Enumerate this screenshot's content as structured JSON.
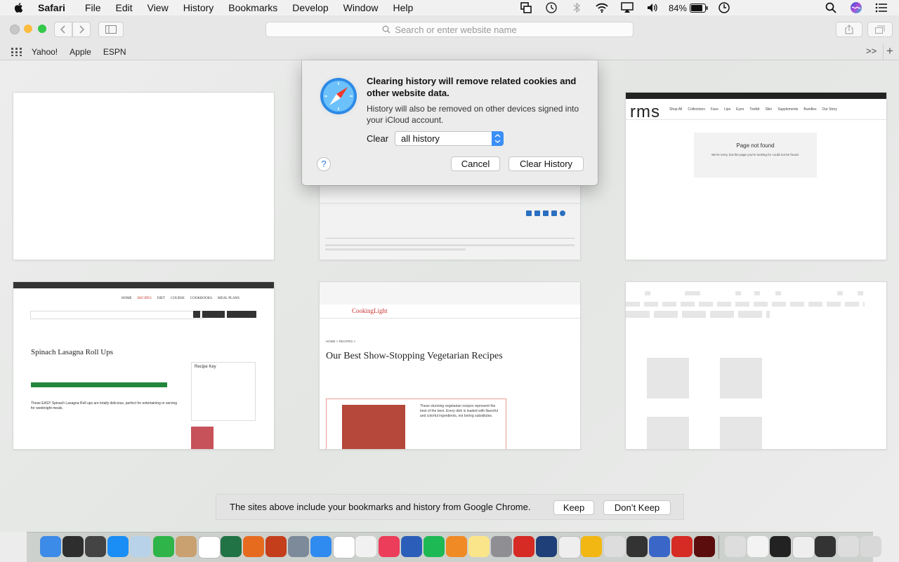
{
  "menubar": {
    "app": "Safari",
    "items": [
      "File",
      "Edit",
      "View",
      "History",
      "Bookmarks",
      "Develop",
      "Window",
      "Help"
    ],
    "battery": "84%"
  },
  "toolbar": {
    "search_placeholder": "Search or enter website name"
  },
  "favorites": [
    "Yahoo!",
    "Apple",
    "ESPN"
  ],
  "dialog": {
    "title": "Clearing history will remove related cookies and other website data.",
    "message": "History will also be removed on other devices signed into your iCloud account.",
    "clear_label": "Clear",
    "clear_option": "all history",
    "cancel": "Cancel",
    "confirm": "Clear History",
    "help": "?"
  },
  "thumbnails": {
    "rms": {
      "logo": "rms",
      "nav": [
        "Shop All",
        "Collections",
        "Face",
        "Lips",
        "Eyes",
        "Toolkit",
        "Skin",
        "Supplements",
        "Bundles",
        "Our Story"
      ],
      "not_found_title": "Page not found",
      "not_found_text": "We're sorry, but the page you're looking for could not be found."
    },
    "skinnytaste": {
      "nav": [
        "HOME",
        "RECIPES",
        "DIET",
        "COURSE",
        "COOKBOOKS",
        "MEAL PLANS"
      ],
      "title": "Spinach Lasagna Roll Ups",
      "intro": "These EASY Spinach Lasagna Roll ups are totally delicious, perfect for entertaining or serving for weeknight meals.",
      "key_title": "Recipe Key"
    },
    "cookinglight": {
      "logo": "CookingLight",
      "title": "Our Best Show-Stopping Vegetarian Recipes",
      "breadcrumb": "HOME > RECIPES >",
      "body": "These stunning vegetarian recipes represent the best of the best. Every dish is loaded with flavorful and colorful ingredients, not boring substitutes."
    }
  },
  "import_bar": {
    "text": "The sites above include your bookmarks and history from Google Chrome.",
    "keep": "Keep",
    "dont_keep": "Don’t Keep"
  },
  "colors": {
    "accent": "#3b8ef7",
    "close": "#fc605b",
    "minimize": "#fdbc40",
    "zoom": "#34c84a"
  },
  "dock_icons": [
    "finder-icon",
    "siri-icon",
    "photo-booth-icon",
    "app-store-icon",
    "preview-icon",
    "facetime-icon",
    "contacts-icon",
    "calendar-icon",
    "excel-icon",
    "firefox-icon",
    "powerpoint-icon",
    "launchpad-icon",
    "safari-icon",
    "chrome-icon",
    "photos-icon",
    "music-icon",
    "word-icon",
    "spotify-icon",
    "books-icon",
    "notes-icon",
    "system-preferences-icon",
    "acrobat-icon",
    "quicktime-icon",
    "blocked-app-icon",
    "onenote-icon",
    "blocked-app-icon-2",
    "printer-icon",
    "keynote-icon",
    "acrobat-reader-icon",
    "flash-icon",
    "document-icon",
    "screenshot-icon",
    "screenshot-icon-2",
    "screenshot-icon-3",
    "screenshot-icon-4",
    "screenshot-icon-5",
    "trash-icon"
  ]
}
